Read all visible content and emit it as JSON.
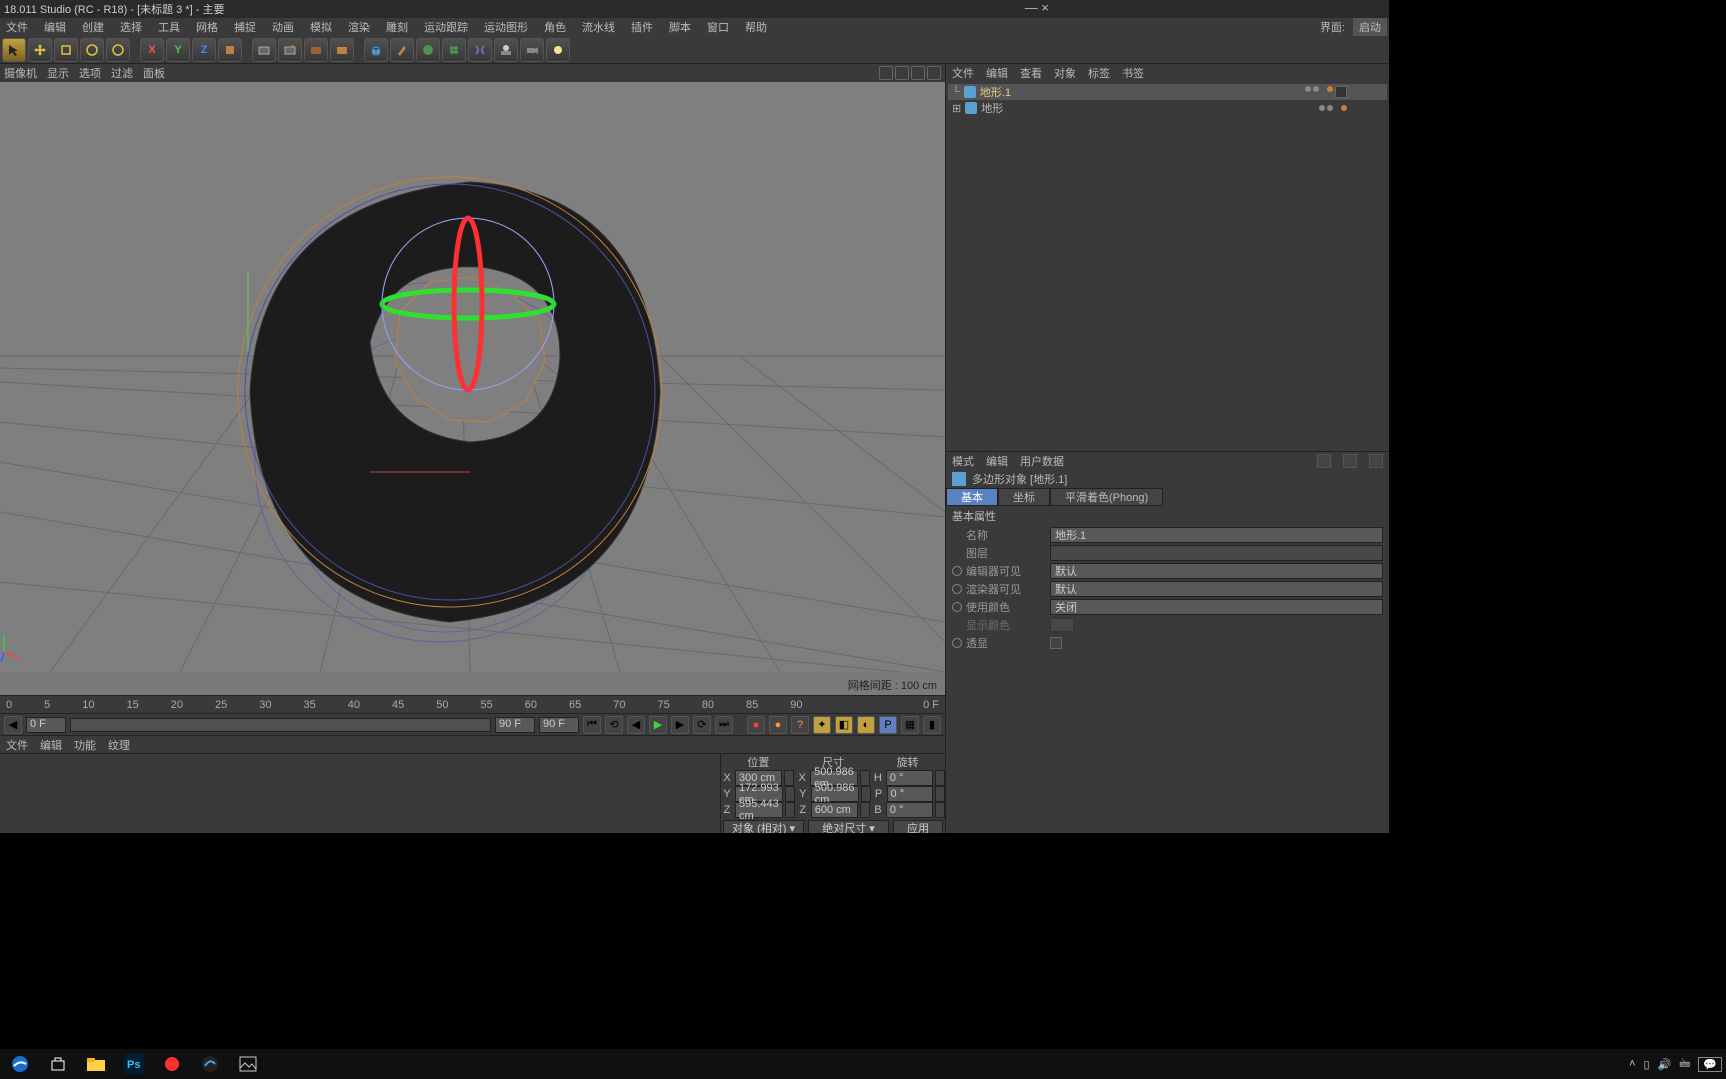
{
  "title": "18.011 Studio (RC - R18) - [未标题 3 *] - 主要",
  "menu": [
    "文件",
    "编辑",
    "创建",
    "选择",
    "工具",
    "网格",
    "捕捉",
    "动画",
    "模拟",
    "渲染",
    "雕刻",
    "运动跟踪",
    "运动图形",
    "角色",
    "流水线",
    "插件",
    "脚本",
    "窗口",
    "帮助"
  ],
  "menu_right": {
    "layout": "界面:",
    "start": "启动"
  },
  "vp_menu": [
    "摄像机",
    "显示",
    "选项",
    "过滤",
    "面板"
  ],
  "vp_footer": "网格间距 : 100 cm",
  "timeline_ticks": [
    "0",
    "5",
    "10",
    "15",
    "20",
    "25",
    "30",
    "35",
    "40",
    "45",
    "50",
    "55",
    "60",
    "65",
    "70",
    "75",
    "80",
    "85",
    "90"
  ],
  "timeline_end": "0 F",
  "playback": {
    "start": "0 F",
    "endA": "90 F",
    "endB": "90 F"
  },
  "material_menu": [
    "文件",
    "编辑",
    "功能",
    "纹理"
  ],
  "coord": {
    "heads": [
      "位置",
      "尺寸",
      "旋转"
    ],
    "rows": [
      {
        "axis": "X",
        "pos": "300 cm",
        "size": "500.986 cm",
        "rot": "0 °",
        "rlbl": "H"
      },
      {
        "axis": "Y",
        "pos": "172.993 cm",
        "size": "500.986 cm",
        "rot": "0 °",
        "rlbl": "P"
      },
      {
        "axis": "Z",
        "pos": "595.443 cm",
        "size": "600 cm",
        "rot": "0 °",
        "rlbl": "B"
      }
    ],
    "dd1": "对象 (相对) ▾",
    "dd2": "绝对尺寸 ▾",
    "apply": "应用"
  },
  "obj_tabs": [
    "文件",
    "编辑",
    "查看",
    "对象",
    "标签",
    "书签"
  ],
  "tree": [
    {
      "name": "地形.1",
      "sel": true,
      "tag": true
    },
    {
      "name": "地形",
      "sel": false,
      "tag": false
    }
  ],
  "attr_tabs": [
    "模式",
    "编辑",
    "用户数据"
  ],
  "attr_title": "多边形对象 [地形.1]",
  "attr_tabbar": [
    "基本",
    "坐标",
    "平滑着色(Phong)"
  ],
  "attr_section": "基本属性",
  "attr_rows": {
    "name": {
      "k": "名称",
      "v": "地形.1"
    },
    "layer": {
      "k": "图层",
      "v": ""
    },
    "editor": {
      "k": "编辑器可见",
      "v": "默认"
    },
    "render": {
      "k": "渲染器可见",
      "v": "默认"
    },
    "usecolor": {
      "k": "使用颜色",
      "v": "关闭"
    },
    "dispcolor": {
      "k": "显示颜色"
    },
    "xray": {
      "k": "透显"
    }
  },
  "win_ctl": "—  ×"
}
